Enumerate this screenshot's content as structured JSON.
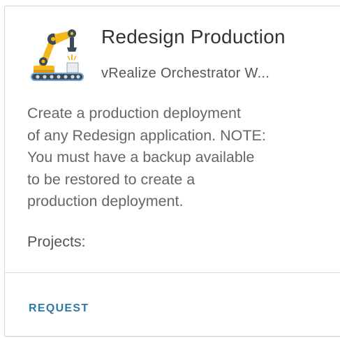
{
  "card": {
    "title": "Redesign Production",
    "subtitle": "vRealize Orchestrator W...",
    "description": " Create a production deployment\nof any Redesign application. NOTE:\nYou must have a backup available\nto be restored to create a\nproduction deployment.",
    "projects_label": "Projects:",
    "request_label": "REQUEST",
    "icon": "robot-arm-conveyor-icon"
  },
  "colors": {
    "accent": "#2c7aa5",
    "title": "#333333",
    "body_text": "#666666",
    "border": "#d7d7d7",
    "icon_yellow": "#f5b71e",
    "icon_dark": "#3c4a55",
    "icon_blue": "#6fa8dc"
  }
}
